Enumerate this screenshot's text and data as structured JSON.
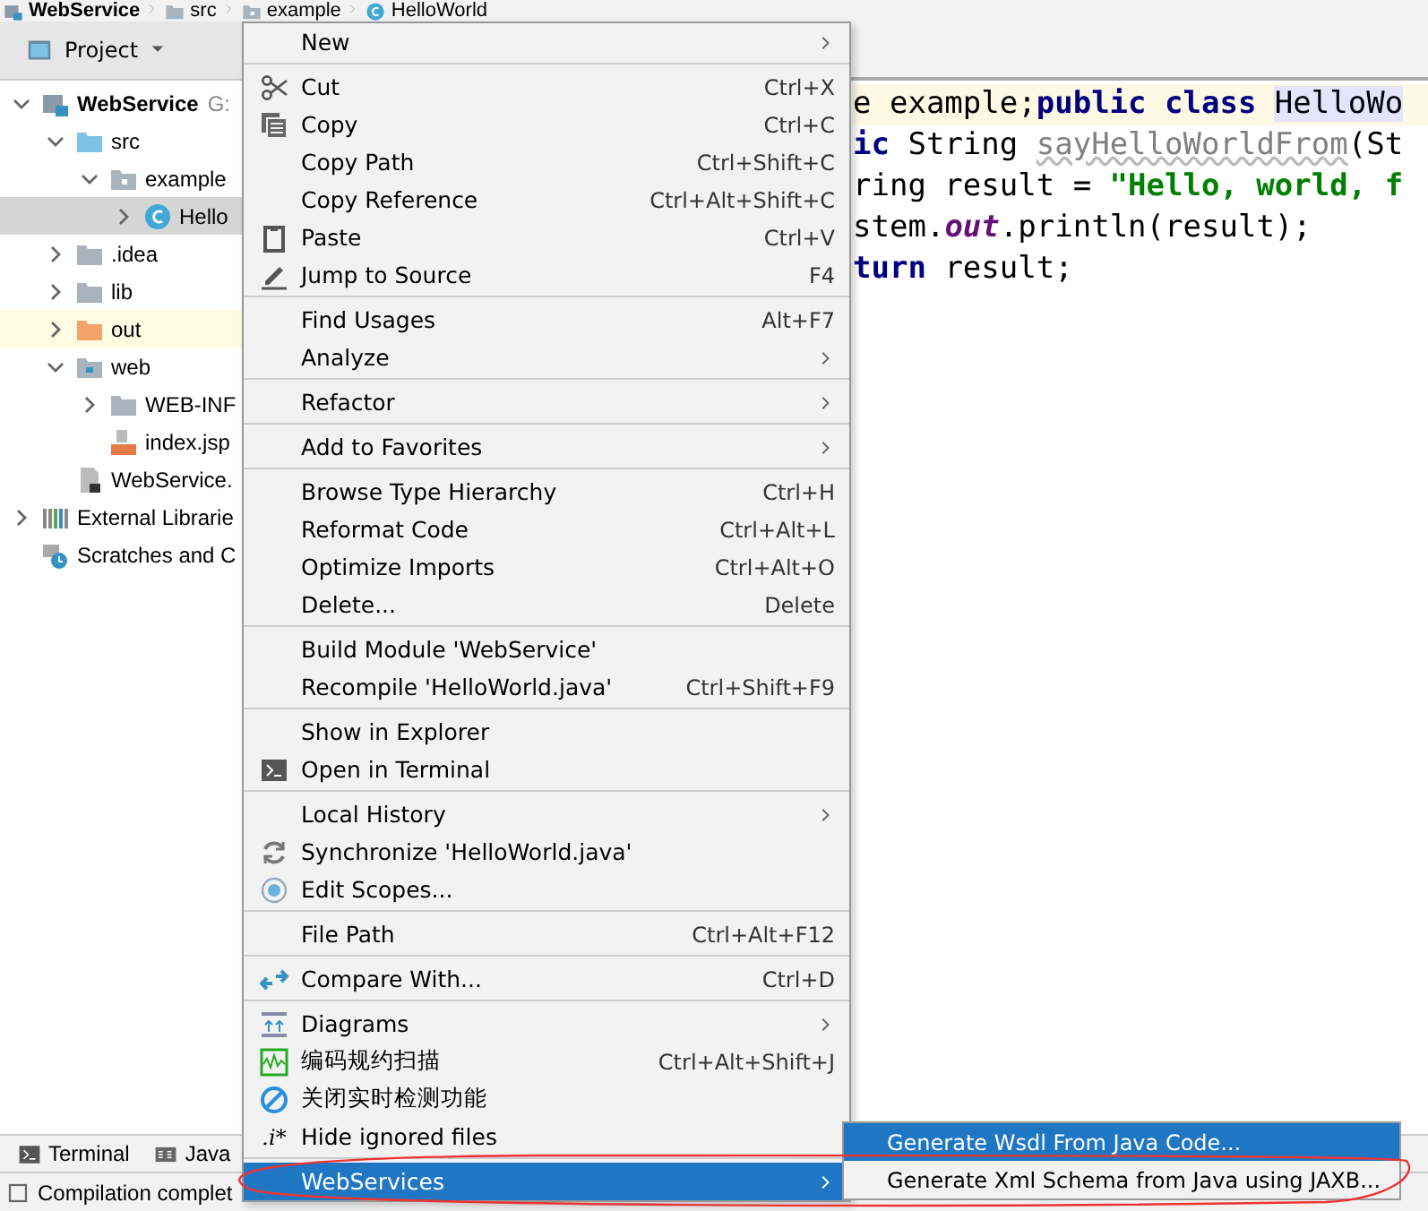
{
  "breadcrumbs": [
    {
      "label": "WebService",
      "kind": "module"
    },
    {
      "label": "src",
      "kind": "folder"
    },
    {
      "label": "example",
      "kind": "package"
    },
    {
      "label": "HelloWorld",
      "kind": "class"
    }
  ],
  "project_panel": {
    "title": "Project",
    "tree": [
      {
        "label": "WebService",
        "hint": "G:",
        "kind": "module",
        "expanded": true,
        "selected": false,
        "children": [
          {
            "label": "src",
            "kind": "source-folder",
            "expanded": true,
            "selected": false,
            "children": [
              {
                "label": "example",
                "kind": "package",
                "expanded": true,
                "selected": false,
                "children": [
                  {
                    "label": "Hello",
                    "kind": "class",
                    "expanded": false,
                    "selected": true
                  }
                ]
              }
            ]
          },
          {
            "label": ".idea",
            "kind": "folder",
            "expanded": false,
            "selected": false
          },
          {
            "label": "lib",
            "kind": "folder",
            "expanded": false,
            "selected": false
          },
          {
            "label": "out",
            "kind": "excluded-folder",
            "expanded": false,
            "selected": false
          },
          {
            "label": "web",
            "kind": "web-folder",
            "expanded": true,
            "selected": false,
            "children": [
              {
                "label": "WEB-INF",
                "kind": "folder",
                "expanded": false,
                "selected": false
              },
              {
                "label": "index.jsp",
                "kind": "jsp",
                "selected": false
              }
            ]
          },
          {
            "label": "WebService.",
            "kind": "module-file",
            "selected": false
          }
        ]
      },
      {
        "label": "External Librarie",
        "kind": "libraries",
        "expanded": false,
        "selected": false
      },
      {
        "label": "Scratches and C",
        "kind": "scratches",
        "selected": false
      }
    ]
  },
  "editor": {
    "lines": [
      {
        "current": true,
        "tokens": [
          {
            "text": "e example;",
            "kind": "plain"
          },
          {
            "text": "public class ",
            "kind": "keyword"
          },
          {
            "text": "HelloWo",
            "kind": "highlight"
          }
        ]
      },
      {
        "current": false,
        "tokens": [
          {
            "text": "ic",
            "kind": "keyword"
          },
          {
            "text": " String ",
            "kind": "plain"
          },
          {
            "text": "sayHelloWorldFrom",
            "kind": "unused"
          },
          {
            "text": "(St",
            "kind": "plain"
          }
        ]
      },
      {
        "current": false,
        "tokens": [
          {
            "text": "ring result = ",
            "kind": "plain"
          },
          {
            "text": "\"Hello, world, f",
            "kind": "string"
          }
        ]
      },
      {
        "current": false,
        "tokens": [
          {
            "text": "stem.",
            "kind": "plain"
          },
          {
            "text": "out",
            "kind": "static"
          },
          {
            "text": ".println(result);",
            "kind": "plain"
          }
        ]
      },
      {
        "current": false,
        "tokens": [
          {
            "text": "turn",
            "kind": "keyword"
          },
          {
            "text": " result;",
            "kind": "plain"
          }
        ]
      }
    ]
  },
  "context_menu": {
    "items": [
      {
        "kind": "item",
        "label": "New",
        "submenu": true,
        "selected": false
      },
      {
        "kind": "separator"
      },
      {
        "kind": "scissors",
        "label": "Cut",
        "shortcut": "Ctrl+X",
        "selected": false
      },
      {
        "kind": "copy",
        "label": "Copy",
        "shortcut": "Ctrl+C",
        "selected": false
      },
      {
        "kind": "item",
        "label": "Copy Path",
        "shortcut": "Ctrl+Shift+C",
        "selected": false
      },
      {
        "kind": "item",
        "label": "Copy Reference",
        "shortcut": "Ctrl+Alt+Shift+C",
        "selected": false
      },
      {
        "kind": "clipboard",
        "label": "Paste",
        "shortcut": "Ctrl+V",
        "selected": false
      },
      {
        "kind": "pencil",
        "label": "Jump to Source",
        "shortcut": "F4",
        "selected": false
      },
      {
        "kind": "separator"
      },
      {
        "kind": "item",
        "label": "Find Usages",
        "shortcut": "Alt+F7",
        "selected": false
      },
      {
        "kind": "item",
        "label": "Analyze",
        "submenu": true,
        "selected": false
      },
      {
        "kind": "separator"
      },
      {
        "kind": "item",
        "label": "Refactor",
        "submenu": true,
        "selected": false
      },
      {
        "kind": "separator"
      },
      {
        "kind": "item",
        "label": "Add to Favorites",
        "submenu": true,
        "selected": false
      },
      {
        "kind": "separator"
      },
      {
        "kind": "item",
        "label": "Browse Type Hierarchy",
        "shortcut": "Ctrl+H",
        "selected": false
      },
      {
        "kind": "item",
        "label": "Reformat Code",
        "shortcut": "Ctrl+Alt+L",
        "selected": false
      },
      {
        "kind": "item",
        "label": "Optimize Imports",
        "shortcut": "Ctrl+Alt+O",
        "selected": false
      },
      {
        "kind": "item",
        "label": "Delete...",
        "shortcut": "Delete",
        "selected": false
      },
      {
        "kind": "separator"
      },
      {
        "kind": "item",
        "label": "Build Module 'WebService'",
        "selected": false
      },
      {
        "kind": "item",
        "label": "Recompile 'HelloWorld.java'",
        "shortcut": "Ctrl+Shift+F9",
        "selected": false
      },
      {
        "kind": "separator"
      },
      {
        "kind": "item",
        "label": "Show in Explorer",
        "selected": false
      },
      {
        "kind": "terminal",
        "label": "Open in Terminal",
        "selected": false
      },
      {
        "kind": "separator"
      },
      {
        "kind": "item",
        "label": "Local History",
        "submenu": true,
        "selected": false
      },
      {
        "kind": "sync",
        "label": "Synchronize 'HelloWorld.java'",
        "selected": false
      },
      {
        "kind": "scope",
        "label": "Edit Scopes...",
        "selected": false
      },
      {
        "kind": "separator"
      },
      {
        "kind": "item",
        "label": "File Path",
        "shortcut": "Ctrl+Alt+F12",
        "selected": false
      },
      {
        "kind": "separator"
      },
      {
        "kind": "compare",
        "label": "Compare With...",
        "shortcut": "Ctrl+D",
        "selected": false
      },
      {
        "kind": "separator"
      },
      {
        "kind": "diagram",
        "label": "Diagrams",
        "submenu": true,
        "selected": false
      },
      {
        "kind": "scan",
        "label": "编码规约扫描",
        "shortcut": "Ctrl+Alt+Shift+J",
        "selected": false
      },
      {
        "kind": "block",
        "label": "关闭实时检测功能",
        "selected": false
      },
      {
        "kind": "item",
        "label": "Hide ignored files",
        "icon_text": ".i*",
        "selected": false
      },
      {
        "kind": "separator"
      },
      {
        "kind": "item",
        "label": "WebServices",
        "submenu": true,
        "selected": true
      }
    ]
  },
  "submenu": {
    "items": [
      {
        "label": "Generate Wsdl From Java Code...",
        "selected": true
      },
      {
        "label": "Generate Xml Schema from Java using JAXB...",
        "selected": false
      }
    ]
  },
  "tool_tabs": [
    {
      "label": "Terminal",
      "kind": "terminal"
    },
    {
      "label": "Java",
      "kind": "ee"
    }
  ],
  "status_bar": {
    "message": "Compilation complet"
  }
}
